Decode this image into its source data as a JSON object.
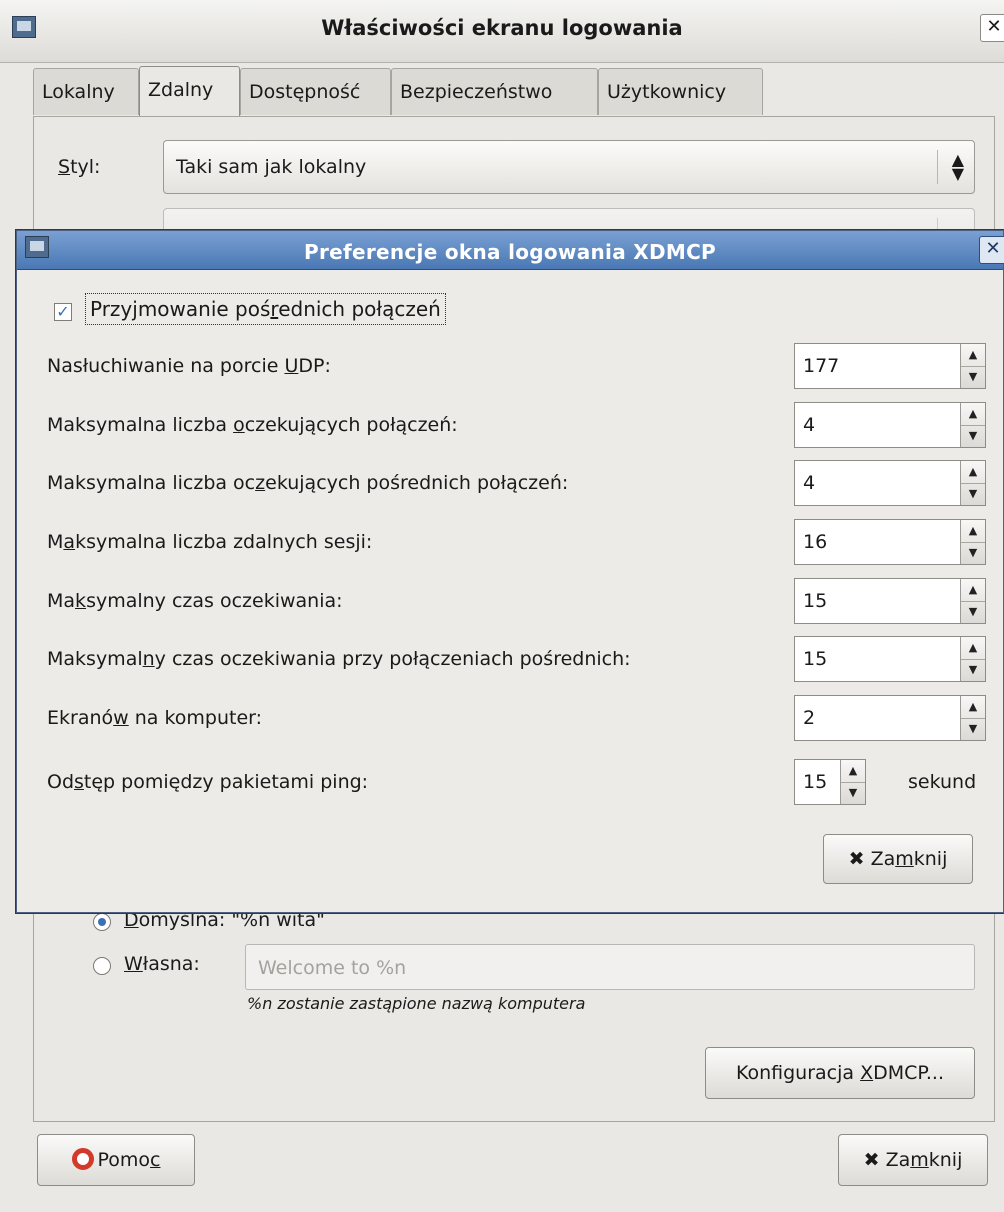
{
  "main": {
    "title": "Właściwości ekranu logowania",
    "tabs": [
      "Lokalny",
      "Zdalny",
      "Dostępność",
      "Bezpieczeństwo",
      "Użytkownicy"
    ],
    "active_tab": "Zdalny",
    "style_label_mn": "S",
    "style_label_rest": "tyl:",
    "style_value": "Taki sam jak lokalny",
    "greeting_default_mn": "D",
    "greeting_default_rest": "omyślna: \"%n wita\"",
    "greeting_custom_mn": "W",
    "greeting_custom_rest": "łasna:",
    "greeting_custom_placeholder": "Welcome to %n",
    "hint": "%n zostanie zastąpione nazwą komputera",
    "xdmcp_button_pre": "Konfiguracja ",
    "xdmcp_button_mn": "X",
    "xdmcp_button_post": "DMCP...",
    "help_pre": "Pomo",
    "help_mn": "c",
    "close_pre": "Za",
    "close_mn": "m",
    "close_post": "knij"
  },
  "dialog": {
    "title": "Preferencje okna logowania XDMCP",
    "checkbox": {
      "pre": "Przyjmowanie poś",
      "mn": "r",
      "post": "ednich połączeń",
      "checked": true
    },
    "rows": [
      {
        "pre": "Nasłuchiwanie na porcie ",
        "mn": "U",
        "post": "DP:",
        "value": "177"
      },
      {
        "pre": "Maksymalna liczba ",
        "mn": "o",
        "post": "czekujących połączeń:",
        "value": "4"
      },
      {
        "pre": "Maksymalna liczba oc",
        "mn": "z",
        "post": "ekujących pośrednich połączeń:",
        "value": "4"
      },
      {
        "pre": "M",
        "mn": "a",
        "post": "ksymalna liczba zdalnych sesji:",
        "value": "16"
      },
      {
        "pre": "Ma",
        "mn": "k",
        "post": "symalny czas oczekiwania:",
        "value": "15"
      },
      {
        "pre": "Maksymal",
        "mn": "n",
        "post": "y czas oczekiwania przy połączeniach pośrednich:",
        "value": "15"
      },
      {
        "pre": "Ekranó",
        "mn": "w",
        "post": " na komputer:",
        "value": "2"
      },
      {
        "pre": "Od",
        "mn": "s",
        "post": "tęp pomiędzy pakietami ping:",
        "value": "15",
        "unit": "sekund"
      }
    ],
    "close_pre": "Za",
    "close_mn": "m",
    "close_post": "knij"
  }
}
